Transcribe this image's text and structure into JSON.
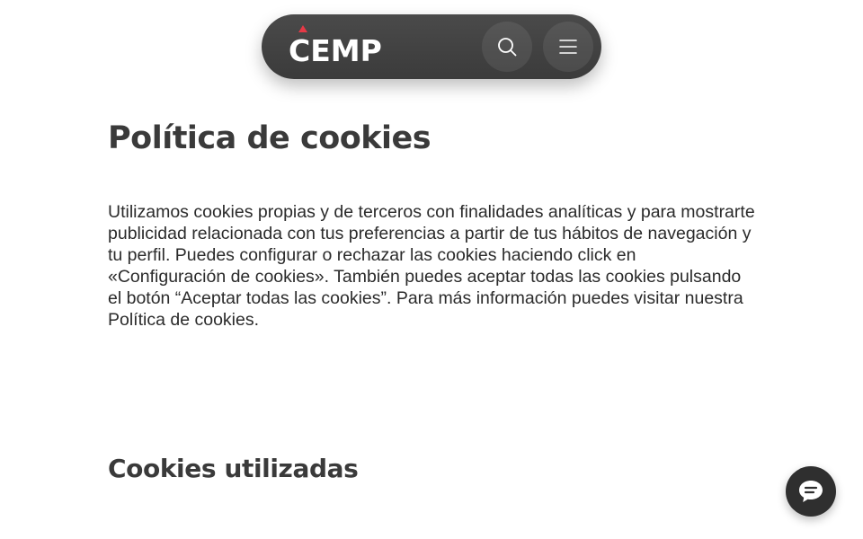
{
  "header": {
    "logo_text": "CEMP",
    "brand_color": "#e63946",
    "search_icon": "search-icon",
    "menu_icon": "hamburger-menu-icon"
  },
  "main": {
    "title": "Política de cookies",
    "intro": "Utilizamos cookies propias y de terceros con finalidades analíticas y para mostrarte publicidad relacionada con tus preferencias a partir de tus hábitos de navegación y tu perfil. Puedes configurar o rechazar las cookies haciendo click en «Configuración de cookies». También puedes aceptar todas las cookies pulsando el botón “Aceptar todas las cookies”. Para más información puedes visitar nuestra Política de cookies.",
    "section_title": "Cookies utilizadas"
  },
  "chat": {
    "icon": "chat-bubble-icon"
  }
}
